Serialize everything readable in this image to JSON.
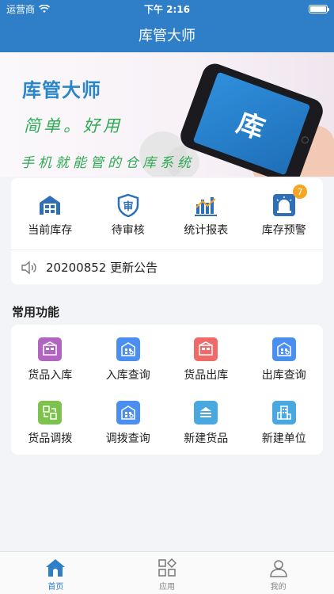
{
  "status_bar": {
    "carrier": "运营商",
    "time": "下午 2:16"
  },
  "navbar": {
    "title": "库管大师"
  },
  "banner": {
    "title": "库管大师",
    "subtitle": "简单。好用",
    "slogan": "手机就能管的仓库系统",
    "phone_text": "库"
  },
  "quick_actions": [
    {
      "label": "当前库存",
      "icon": "warehouse-icon"
    },
    {
      "label": "待审核",
      "icon": "shield-review-icon"
    },
    {
      "label": "统计报表",
      "icon": "bar-chart-icon"
    },
    {
      "label": "库存预警",
      "icon": "alarm-light-icon",
      "badge": "7"
    }
  ],
  "notice": {
    "text": "20200852 更新公告",
    "icon": "speaker-icon"
  },
  "common_functions": {
    "title": "常用功能",
    "items": [
      {
        "label": "货品入库",
        "icon": "goods-in-icon",
        "color": "#b265c0"
      },
      {
        "label": "入库查询",
        "icon": "inbound-query-icon",
        "color": "#4a8ef0"
      },
      {
        "label": "货品出库",
        "icon": "goods-out-icon",
        "color": "#f06a6a"
      },
      {
        "label": "出库查询",
        "icon": "outbound-query-icon",
        "color": "#4a8ef0"
      },
      {
        "label": "货品调拨",
        "icon": "transfer-icon",
        "color": "#7cc24d"
      },
      {
        "label": "调拨查询",
        "icon": "transfer-query-icon",
        "color": "#4a8ef0"
      },
      {
        "label": "新建货品",
        "icon": "new-goods-icon",
        "color": "#4aa8e0"
      },
      {
        "label": "新建单位",
        "icon": "new-unit-icon",
        "color": "#4aa8e0"
      }
    ]
  },
  "tabbar": {
    "items": [
      {
        "label": "首页",
        "icon": "home-icon",
        "active": true
      },
      {
        "label": "应用",
        "icon": "apps-icon",
        "active": false
      },
      {
        "label": "我的",
        "icon": "user-icon",
        "active": false
      }
    ]
  },
  "colors": {
    "brand": "#2f7fc8",
    "badge": "#f5a623",
    "slogan_green": "#2faa55"
  }
}
